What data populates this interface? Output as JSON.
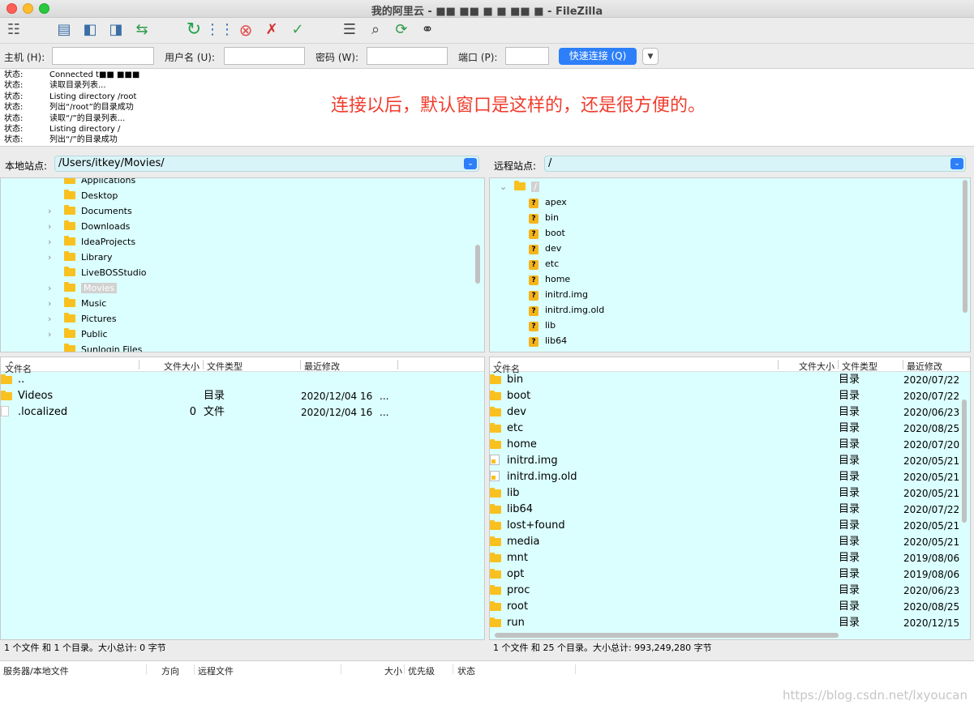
{
  "window": {
    "title": "我的阿里云 - ■■ ■■ ■ ■ ■■ ■ - FileZilla"
  },
  "toolbar": {
    "icons": [
      "site-manager-icon",
      "message-log-icon",
      "local-tree-icon",
      "remote-tree-icon",
      "transfer-queue-icon",
      "refresh-icon",
      "process-queue-icon",
      "cancel-icon",
      "disconnect-icon",
      "reconnect-icon",
      "dir-compare-icon",
      "filter-icon",
      "sync-browse-icon",
      "search-icon"
    ]
  },
  "quickconnect": {
    "host_label": "主机 (H):",
    "user_label": "用户名 (U):",
    "pass_label": "密码 (W):",
    "port_label": "端口 (P):",
    "connect_label": "快速连接 (Q)",
    "host_value": "",
    "user_value": "",
    "pass_value": "",
    "port_value": ""
  },
  "log": {
    "lines": [
      {
        "key": "状态:",
        "text": "Connected t■■ ■■■"
      },
      {
        "key": "状态:",
        "text": "读取目录列表..."
      },
      {
        "key": "状态:",
        "text": "Listing directory /root"
      },
      {
        "key": "状态:",
        "text": "列出“/root”的目录成功"
      },
      {
        "key": "状态:",
        "text": "读取“/”的目录列表..."
      },
      {
        "key": "状态:",
        "text": "Listing directory /"
      },
      {
        "key": "状态:",
        "text": "列出“/”的目录成功"
      }
    ],
    "annotation": "连接以后，默认窗口是这样的，还是很方便的。"
  },
  "local": {
    "site_label": "本地站点:",
    "path": "/Users/itkey/Movies/",
    "tree": [
      {
        "name": "Applications",
        "expandable": false,
        "selected": false
      },
      {
        "name": "Desktop",
        "expandable": false,
        "selected": false
      },
      {
        "name": "Documents",
        "expandable": true,
        "selected": false
      },
      {
        "name": "Downloads",
        "expandable": true,
        "selected": false
      },
      {
        "name": "IdeaProjects",
        "expandable": true,
        "selected": false
      },
      {
        "name": "Library",
        "expandable": true,
        "selected": false
      },
      {
        "name": "LiveBOSStudio",
        "expandable": false,
        "selected": false
      },
      {
        "name": "Movies",
        "expandable": true,
        "selected": true
      },
      {
        "name": "Music",
        "expandable": true,
        "selected": false
      },
      {
        "name": "Pictures",
        "expandable": true,
        "selected": false
      },
      {
        "name": "Public",
        "expandable": true,
        "selected": false
      },
      {
        "name": "Sunlogin Files",
        "expandable": false,
        "selected": false
      }
    ],
    "columns": {
      "name": "文件名",
      "size": "文件大小",
      "type": "文件类型",
      "modified": "最近修改"
    },
    "files": [
      {
        "icon": "folder",
        "name": "..",
        "size": "",
        "type": "",
        "modified": ""
      },
      {
        "icon": "folder",
        "name": "Videos",
        "size": "",
        "type": "目录",
        "modified": "2020/12/04 16",
        "more": "..."
      },
      {
        "icon": "file",
        "name": ".localized",
        "size": "0",
        "type": "文件",
        "modified": "2020/12/04 16",
        "more": "..."
      }
    ],
    "status": "1 个文件 和 1 个目录。大小总计: 0 字节"
  },
  "remote": {
    "site_label": "远程站点:",
    "path": "/",
    "tree_root": "/",
    "tree": [
      "apex",
      "bin",
      "boot",
      "dev",
      "etc",
      "home",
      "initrd.img",
      "initrd.img.old",
      "lib",
      "lib64"
    ],
    "columns": {
      "name": "文件名",
      "size": "文件大小",
      "type": "文件类型",
      "modified": "最近修改"
    },
    "files": [
      {
        "icon": "folder",
        "name": "bin",
        "type": "目录",
        "modified": "2020/07/22"
      },
      {
        "icon": "folder",
        "name": "boot",
        "type": "目录",
        "modified": "2020/07/22"
      },
      {
        "icon": "folder",
        "name": "dev",
        "type": "目录",
        "modified": "2020/06/23"
      },
      {
        "icon": "folder",
        "name": "etc",
        "type": "目录",
        "modified": "2020/08/25"
      },
      {
        "icon": "folder",
        "name": "home",
        "type": "目录",
        "modified": "2020/07/20"
      },
      {
        "icon": "link",
        "name": "initrd.img",
        "type": "目录",
        "modified": "2020/05/21"
      },
      {
        "icon": "link",
        "name": "initrd.img.old",
        "type": "目录",
        "modified": "2020/05/21"
      },
      {
        "icon": "folder",
        "name": "lib",
        "type": "目录",
        "modified": "2020/05/21"
      },
      {
        "icon": "folder",
        "name": "lib64",
        "type": "目录",
        "modified": "2020/07/22"
      },
      {
        "icon": "folder",
        "name": "lost+found",
        "type": "目录",
        "modified": "2020/05/21"
      },
      {
        "icon": "folder",
        "name": "media",
        "type": "目录",
        "modified": "2020/05/21"
      },
      {
        "icon": "folder",
        "name": "mnt",
        "type": "目录",
        "modified": "2019/08/06"
      },
      {
        "icon": "folder",
        "name": "opt",
        "type": "目录",
        "modified": "2019/08/06"
      },
      {
        "icon": "folder",
        "name": "proc",
        "type": "目录",
        "modified": "2020/06/23"
      },
      {
        "icon": "folder",
        "name": "root",
        "type": "目录",
        "modified": "2020/08/25"
      },
      {
        "icon": "folder",
        "name": "run",
        "type": "目录",
        "modified": "2020/12/15"
      }
    ],
    "status": "1 个文件 和 25 个目录。大小总计: 993,249,280 字节"
  },
  "queue": {
    "columns": [
      "服务器/本地文件",
      "方向",
      "远程文件",
      "大小",
      "优先级",
      "状态"
    ]
  },
  "watermark": "https://blog.csdn.net/lxyoucan"
}
